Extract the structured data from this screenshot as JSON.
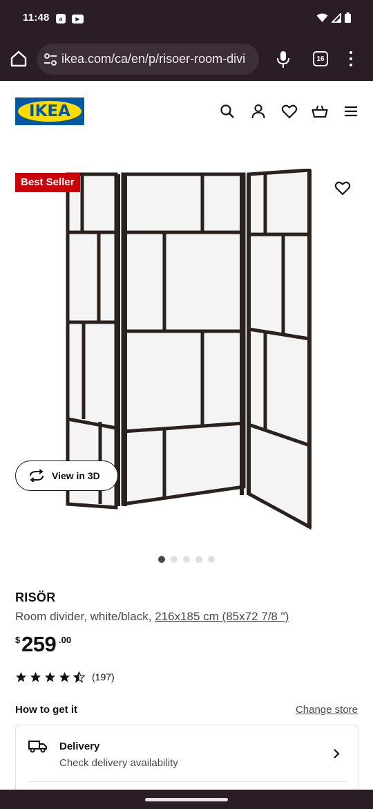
{
  "status_bar": {
    "time": "11:48",
    "icons": [
      "notification-app-icon",
      "youtube-icon",
      "wifi-icon",
      "signal-icon",
      "battery-icon"
    ]
  },
  "browser": {
    "url": "ikea.com/ca/en/p/risoer-room-divi",
    "tab_count": "16",
    "icons": [
      "home-icon",
      "site-settings-icon",
      "mic-icon",
      "tabs-icon",
      "overflow-menu-icon"
    ]
  },
  "header": {
    "logo_text": "IKEA",
    "icons": [
      "search-icon",
      "account-icon",
      "heart-icon",
      "cart-icon",
      "hamburger-menu-icon"
    ]
  },
  "product": {
    "badge": "Best Seller",
    "view_3d_label": "View in 3D",
    "image_count": 5,
    "active_image_index": 0,
    "name": "RISÖR",
    "description_prefix": "Room divider, white/black, ",
    "size_link": "216x185 cm (85x72 7/8 \")",
    "price_currency": "$",
    "price_integer": "259",
    "price_decimal": ".00",
    "rating_value": 4.5,
    "rating_max": 5,
    "review_count": "(197)"
  },
  "availability": {
    "title": "How to get it",
    "change_store": "Change store",
    "delivery_title": "Delivery",
    "delivery_subtitle": "Check delivery availability"
  },
  "colors": {
    "system_bar": "#2b1d25",
    "ikea_blue": "#0058a3",
    "ikea_yellow": "#ffdb00",
    "badge_red": "#cc0008",
    "frame_black": "#2a221f"
  }
}
